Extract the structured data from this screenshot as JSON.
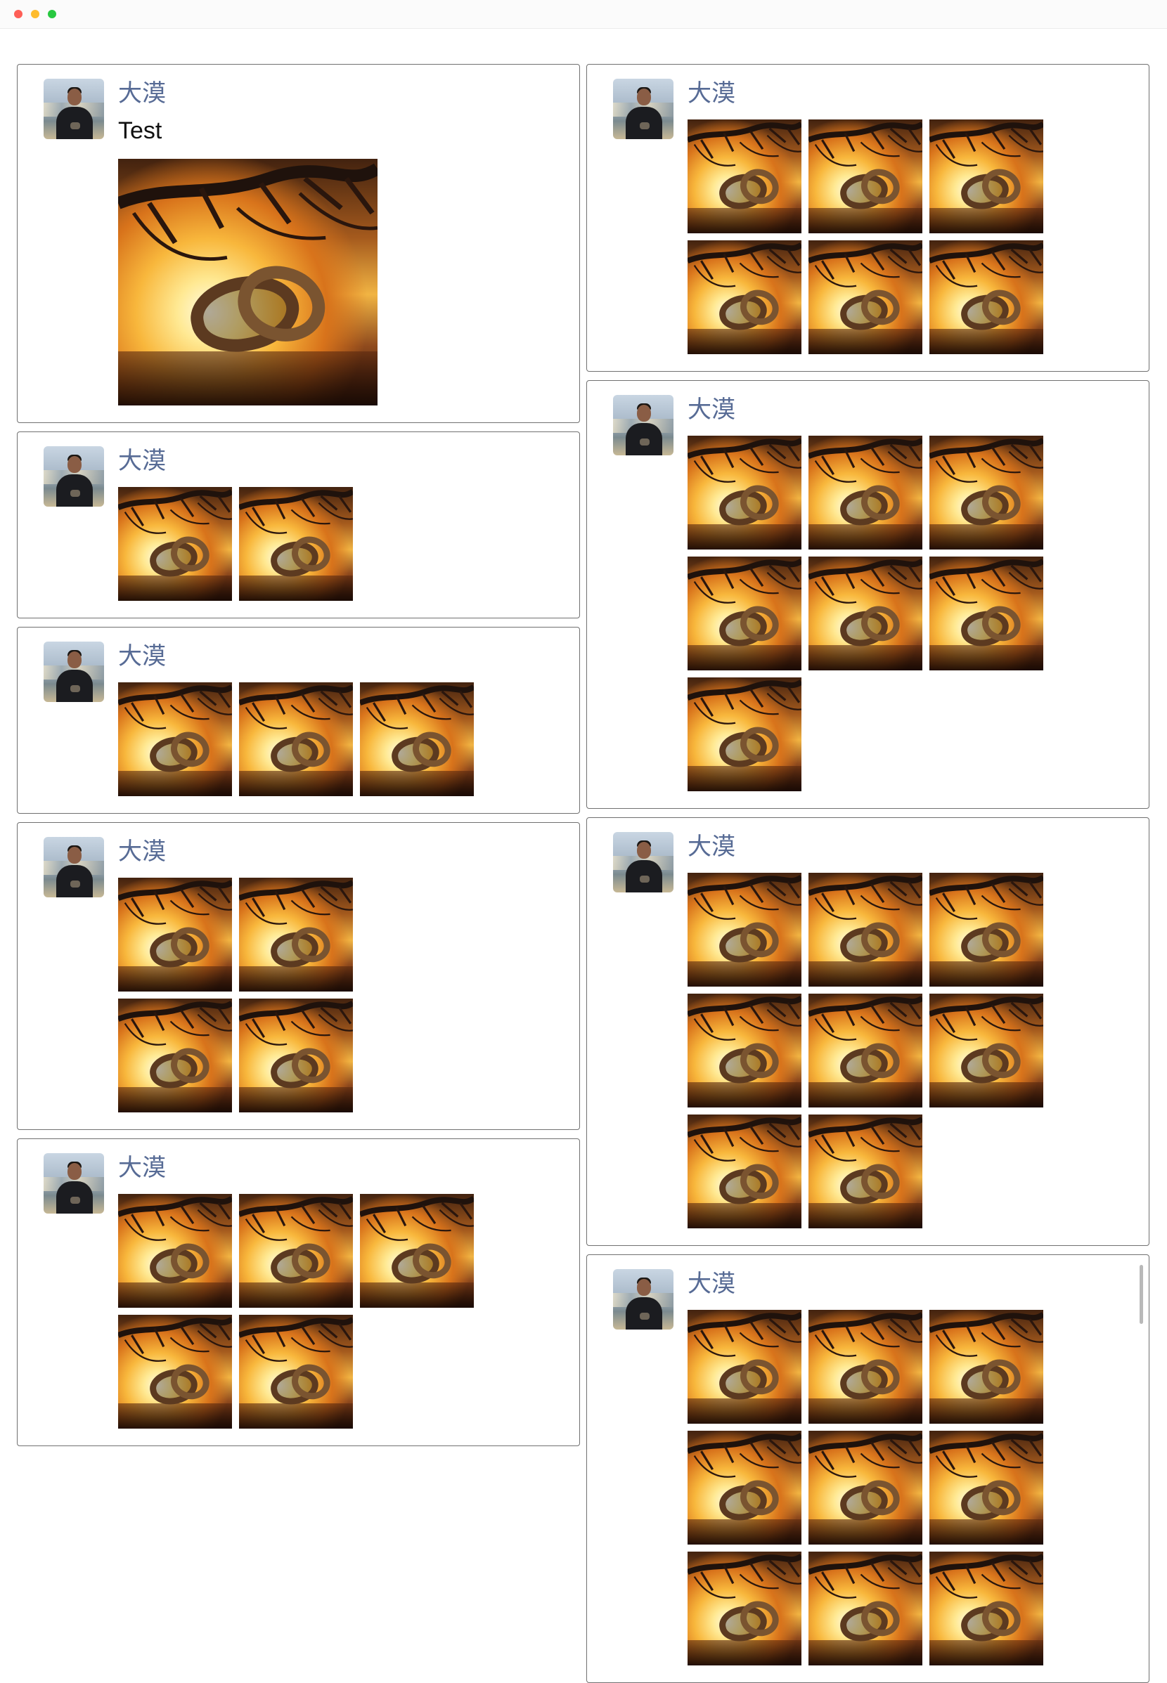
{
  "window": {
    "controls": [
      "close",
      "minimize",
      "zoom"
    ]
  },
  "user_name": "大漠",
  "photo_icon": "heart-swing-sunset-photo",
  "colors": {
    "name": "#576b95",
    "border": "#707070",
    "photo_warm": "#f1b443"
  },
  "posts_left": [
    {
      "name": "大漠",
      "text": "Test",
      "image_count": 1
    },
    {
      "name": "大漠",
      "image_count": 2
    },
    {
      "name": "大漠",
      "image_count": 3
    },
    {
      "name": "大漠",
      "image_count": 4
    },
    {
      "name": "大漠",
      "image_count": 5
    }
  ],
  "posts_right": [
    {
      "name": "大漠",
      "image_count": 6
    },
    {
      "name": "大漠",
      "image_count": 7
    },
    {
      "name": "大漠",
      "image_count": 8
    },
    {
      "name": "大漠",
      "image_count": 9
    }
  ]
}
